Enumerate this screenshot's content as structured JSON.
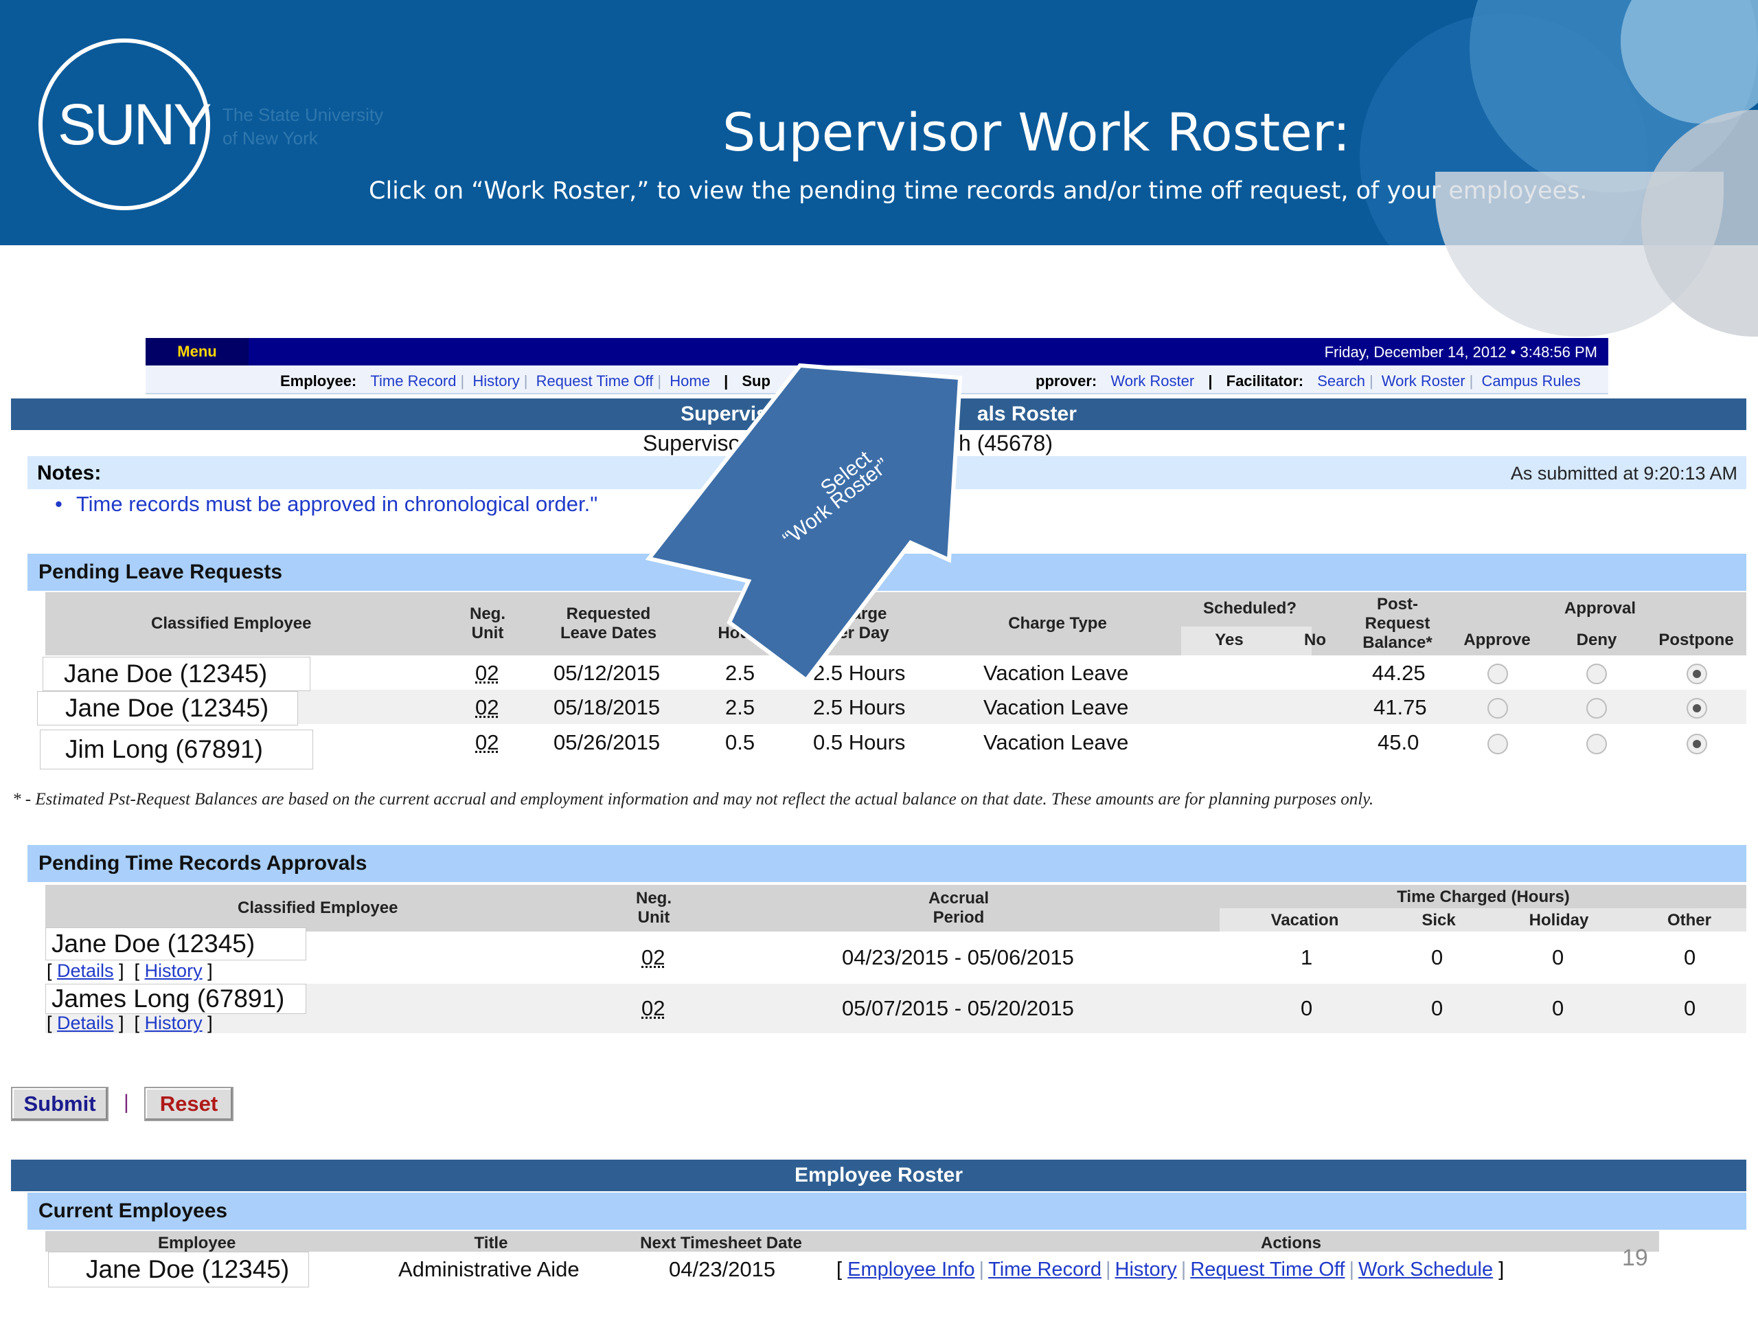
{
  "slide": {
    "logo_text": "SUNY",
    "logo_subtitle_line1": "The State University",
    "logo_subtitle_line2": "of New York",
    "title": "Supervisor Work Roster:",
    "subtitle": "Click on “Work Roster,” to view the pending time records and/or time off request, of your employees.",
    "page_number": "19",
    "callout_line1": "Select",
    "callout_line2": "“Work Roster”"
  },
  "menubar": {
    "menu_label": "Menu",
    "datetime": "Friday, December 14, 2012 • 3:48:56 PM"
  },
  "linkbar": {
    "employee_label": "Employee:",
    "employee_links": [
      "Time Record",
      "History",
      "Request Time Off",
      "Home"
    ],
    "supervisor_label_visible": "Sup",
    "approver_label_visible": "pprover:",
    "supervisor_links": [
      "Work Roster"
    ],
    "facilitator_label": "Facilitator:",
    "facilitator_links": [
      "Search",
      "Work Roster",
      "Campus Rules"
    ]
  },
  "approvals_header": {
    "title_left": "Supervisor Pe",
    "title_right": "als Roster",
    "supervisor_left": "Supervisor(Desi",
    "supervisor_right": "h (45678)"
  },
  "notes": {
    "label": "Notes:",
    "submitted": "As submitted at 9:20:13 AM",
    "item": "Time records must be approved in chronological order.\""
  },
  "leave_requests": {
    "title": "Pending Leave Requests",
    "headers": {
      "employee": "Classified Employee",
      "neg_unit": [
        "Neg.",
        "Unit"
      ],
      "dates": [
        "Requested",
        "Leave Dates"
      ],
      "hours": [
        "#",
        "Hours"
      ],
      "charge_per_day": [
        "Charge",
        "Per Day"
      ],
      "charge_type": "Charge Type",
      "scheduled": "Scheduled?",
      "yes": "Yes",
      "no": "No",
      "balance": [
        "Post-",
        "Request",
        "Balance*"
      ],
      "approval": "Approval",
      "approve": "Approve",
      "deny": "Deny",
      "postpone": "Postpone"
    },
    "rows": [
      {
        "employee": "Jane Doe (12345)",
        "neg_unit": "02",
        "dates": "05/12/2015",
        "hours": "2.5",
        "per_day": "2.5 Hours",
        "type": "Vacation Leave",
        "balance": "44.25",
        "selected": "postpone"
      },
      {
        "employee": "Jane Doe (12345)",
        "neg_unit": "02",
        "dates": "05/18/2015",
        "hours": "2.5",
        "per_day": "2.5 Hours",
        "type": "Vacation Leave",
        "balance": "41.75",
        "selected": "postpone"
      },
      {
        "employee": "Jim Long (67891)",
        "neg_unit": "02",
        "dates": "05/26/2015",
        "hours": "0.5",
        "per_day": "0.5 Hours",
        "type": "Vacation Leave",
        "balance": "45.0",
        "selected": "postpone"
      }
    ],
    "footnote": "* - Estimated Pst-Request Balances are based on the current accrual and employment information and may not reflect the actual balance on that date. These amounts are for planning purposes only."
  },
  "time_records": {
    "title": "Pending Time Records Approvals",
    "headers": {
      "employee": "Classified Employee",
      "neg_unit": [
        "Neg.",
        "Unit"
      ],
      "accrual": [
        "Accrual",
        "Period"
      ],
      "time_charged": "Time Charged (Hours)",
      "vacation": "Vacation",
      "sick": "Sick",
      "holiday": "Holiday",
      "other": "Other"
    },
    "details_label": "Details",
    "history_label": "History",
    "rows": [
      {
        "employee": "Jane Doe (12345)",
        "neg_unit": "02",
        "period": "04/23/2015 - 05/06/2015",
        "vacation": "1",
        "sick": "0",
        "holiday": "0",
        "other": "0"
      },
      {
        "employee": "James Long (67891)",
        "neg_unit": "02",
        "period": "05/07/2015 - 05/20/2015",
        "vacation": "0",
        "sick": "0",
        "holiday": "0",
        "other": "0"
      }
    ]
  },
  "buttons": {
    "submit": "Submit",
    "divider": "|",
    "reset": "Reset"
  },
  "roster": {
    "title": "Employee Roster",
    "section": "Current Employees",
    "headers": {
      "employee": "Employee",
      "title": "Title",
      "next_date": "Next Timesheet Date",
      "actions": "Actions"
    },
    "row": {
      "employee": "Jane Doe (12345)",
      "title": "Administrative Aide",
      "next_date": "04/23/2015",
      "actions": [
        "Employee Info",
        "Time Record",
        "History",
        "Request Time Off",
        "Work Schedule"
      ]
    }
  },
  "colors": {
    "banner": "#0a5a9a",
    "menubar": "#00008b",
    "header_dark": "#2f5f92",
    "header_light": "#a9cffa",
    "link": "#1f3ac9",
    "callout": "#3d6ea8"
  }
}
